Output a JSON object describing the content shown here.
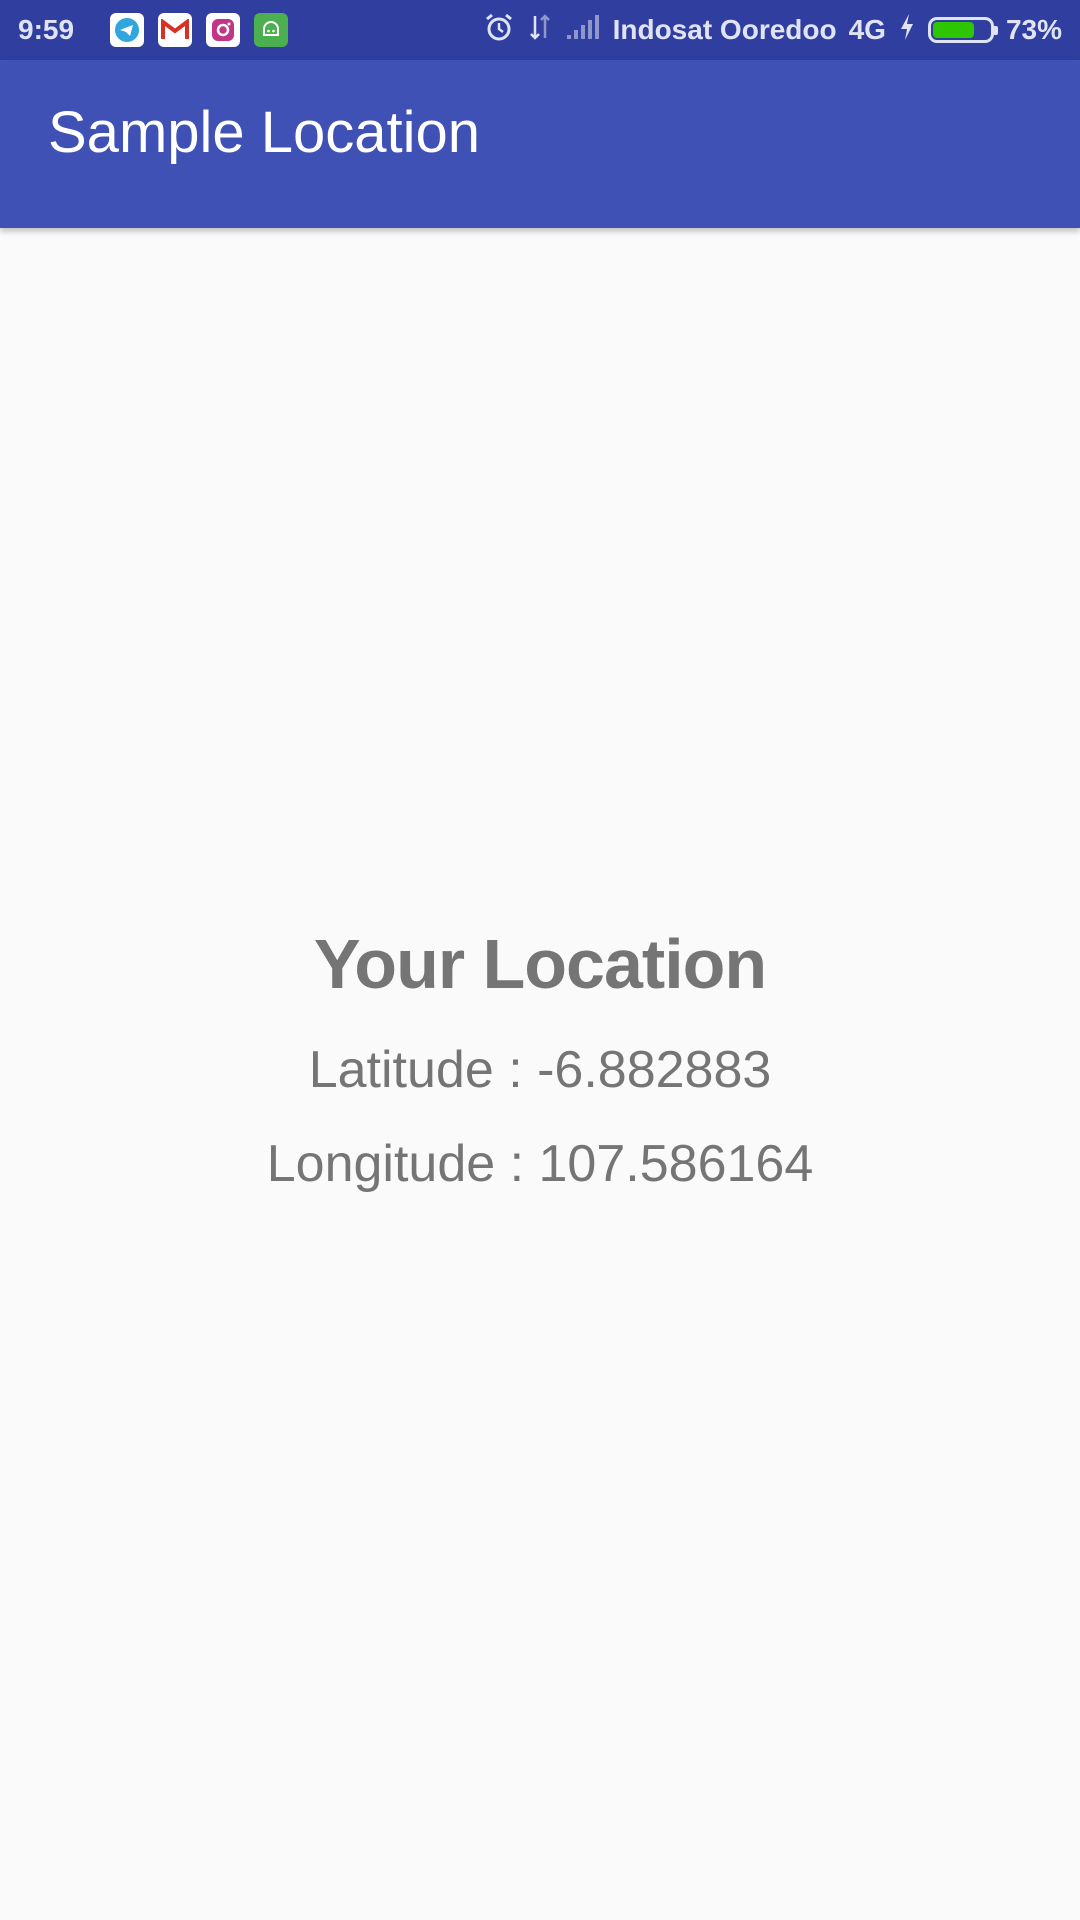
{
  "status_bar": {
    "time": "9:59",
    "carrier": "Indosat Ooredoo",
    "network": "4G",
    "battery_percent": "73%",
    "battery_level": 0.73,
    "notification_icons": [
      "telegram-icon",
      "gmail-icon",
      "instagram-icon",
      "android-robot-icon"
    ],
    "status_icons": [
      "alarm-icon",
      "data-transfer-icon",
      "signal-icon",
      "charging-icon",
      "battery-icon"
    ]
  },
  "app_bar": {
    "title": "Sample Location",
    "color": "#3f51b5"
  },
  "location": {
    "heading": "Your Location",
    "latitude_text": "Latitude : -6.882883",
    "longitude_text": "Longitude : 107.586164"
  },
  "colors": {
    "status_bar": "#303f9f",
    "text": "#757575",
    "background": "#fafafa"
  }
}
